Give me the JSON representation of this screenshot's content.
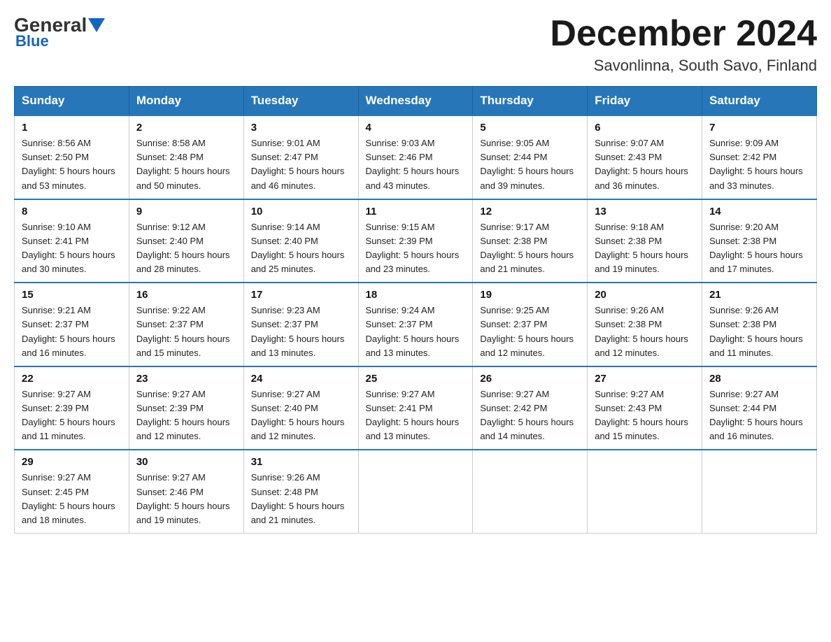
{
  "logo": {
    "general": "General",
    "blue": "Blue"
  },
  "title": "December 2024",
  "location": "Savonlinna, South Savo, Finland",
  "days_of_week": [
    "Sunday",
    "Monday",
    "Tuesday",
    "Wednesday",
    "Thursday",
    "Friday",
    "Saturday"
  ],
  "weeks": [
    [
      {
        "day": "1",
        "sunrise": "8:56 AM",
        "sunset": "2:50 PM",
        "daylight": "5 hours and 53 minutes."
      },
      {
        "day": "2",
        "sunrise": "8:58 AM",
        "sunset": "2:48 PM",
        "daylight": "5 hours and 50 minutes."
      },
      {
        "day": "3",
        "sunrise": "9:01 AM",
        "sunset": "2:47 PM",
        "daylight": "5 hours and 46 minutes."
      },
      {
        "day": "4",
        "sunrise": "9:03 AM",
        "sunset": "2:46 PM",
        "daylight": "5 hours and 43 minutes."
      },
      {
        "day": "5",
        "sunrise": "9:05 AM",
        "sunset": "2:44 PM",
        "daylight": "5 hours and 39 minutes."
      },
      {
        "day": "6",
        "sunrise": "9:07 AM",
        "sunset": "2:43 PM",
        "daylight": "5 hours and 36 minutes."
      },
      {
        "day": "7",
        "sunrise": "9:09 AM",
        "sunset": "2:42 PM",
        "daylight": "5 hours and 33 minutes."
      }
    ],
    [
      {
        "day": "8",
        "sunrise": "9:10 AM",
        "sunset": "2:41 PM",
        "daylight": "5 hours and 30 minutes."
      },
      {
        "day": "9",
        "sunrise": "9:12 AM",
        "sunset": "2:40 PM",
        "daylight": "5 hours and 28 minutes."
      },
      {
        "day": "10",
        "sunrise": "9:14 AM",
        "sunset": "2:40 PM",
        "daylight": "5 hours and 25 minutes."
      },
      {
        "day": "11",
        "sunrise": "9:15 AM",
        "sunset": "2:39 PM",
        "daylight": "5 hours and 23 minutes."
      },
      {
        "day": "12",
        "sunrise": "9:17 AM",
        "sunset": "2:38 PM",
        "daylight": "5 hours and 21 minutes."
      },
      {
        "day": "13",
        "sunrise": "9:18 AM",
        "sunset": "2:38 PM",
        "daylight": "5 hours and 19 minutes."
      },
      {
        "day": "14",
        "sunrise": "9:20 AM",
        "sunset": "2:38 PM",
        "daylight": "5 hours and 17 minutes."
      }
    ],
    [
      {
        "day": "15",
        "sunrise": "9:21 AM",
        "sunset": "2:37 PM",
        "daylight": "5 hours and 16 minutes."
      },
      {
        "day": "16",
        "sunrise": "9:22 AM",
        "sunset": "2:37 PM",
        "daylight": "5 hours and 15 minutes."
      },
      {
        "day": "17",
        "sunrise": "9:23 AM",
        "sunset": "2:37 PM",
        "daylight": "5 hours and 13 minutes."
      },
      {
        "day": "18",
        "sunrise": "9:24 AM",
        "sunset": "2:37 PM",
        "daylight": "5 hours and 13 minutes."
      },
      {
        "day": "19",
        "sunrise": "9:25 AM",
        "sunset": "2:37 PM",
        "daylight": "5 hours and 12 minutes."
      },
      {
        "day": "20",
        "sunrise": "9:26 AM",
        "sunset": "2:38 PM",
        "daylight": "5 hours and 12 minutes."
      },
      {
        "day": "21",
        "sunrise": "9:26 AM",
        "sunset": "2:38 PM",
        "daylight": "5 hours and 11 minutes."
      }
    ],
    [
      {
        "day": "22",
        "sunrise": "9:27 AM",
        "sunset": "2:39 PM",
        "daylight": "5 hours and 11 minutes."
      },
      {
        "day": "23",
        "sunrise": "9:27 AM",
        "sunset": "2:39 PM",
        "daylight": "5 hours and 12 minutes."
      },
      {
        "day": "24",
        "sunrise": "9:27 AM",
        "sunset": "2:40 PM",
        "daylight": "5 hours and 12 minutes."
      },
      {
        "day": "25",
        "sunrise": "9:27 AM",
        "sunset": "2:41 PM",
        "daylight": "5 hours and 13 minutes."
      },
      {
        "day": "26",
        "sunrise": "9:27 AM",
        "sunset": "2:42 PM",
        "daylight": "5 hours and 14 minutes."
      },
      {
        "day": "27",
        "sunrise": "9:27 AM",
        "sunset": "2:43 PM",
        "daylight": "5 hours and 15 minutes."
      },
      {
        "day": "28",
        "sunrise": "9:27 AM",
        "sunset": "2:44 PM",
        "daylight": "5 hours and 16 minutes."
      }
    ],
    [
      {
        "day": "29",
        "sunrise": "9:27 AM",
        "sunset": "2:45 PM",
        "daylight": "5 hours and 18 minutes."
      },
      {
        "day": "30",
        "sunrise": "9:27 AM",
        "sunset": "2:46 PM",
        "daylight": "5 hours and 19 minutes."
      },
      {
        "day": "31",
        "sunrise": "9:26 AM",
        "sunset": "2:48 PM",
        "daylight": "5 hours and 21 minutes."
      },
      null,
      null,
      null,
      null
    ]
  ]
}
